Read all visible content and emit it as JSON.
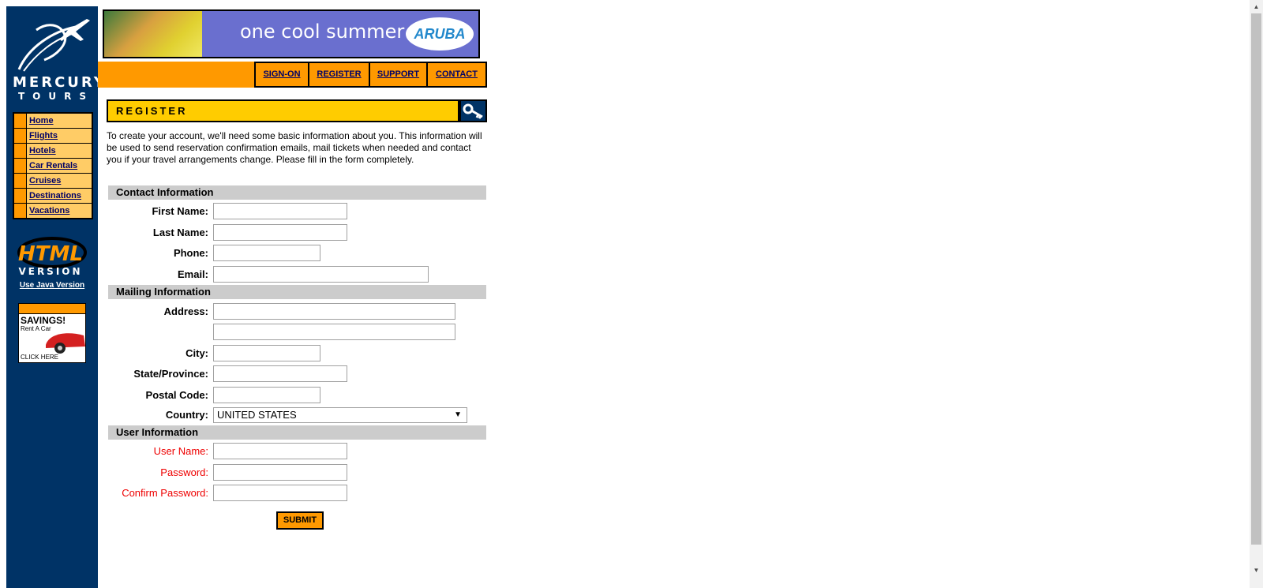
{
  "logo": {
    "line1": "MERCURY",
    "line2": "TOURS"
  },
  "sidenav": [
    "Home",
    "Flights",
    "Hotels",
    "Car Rentals",
    "Cruises",
    "Destinations",
    "Vacations"
  ],
  "badge": {
    "html": "HTML",
    "version": "VERSION"
  },
  "java_link": "Use Java Version",
  "ad": {
    "title": "SAVINGS!",
    "sub": "Rent A Car",
    "cta": "CLICK HERE"
  },
  "banner": {
    "text": "one cool summer",
    "brand": "ARUBA"
  },
  "topnav": [
    "SIGN-ON",
    "REGISTER",
    "SUPPORT",
    "CONTACT"
  ],
  "page_title": "REGISTER",
  "intro": "To create your account, we'll need some basic information about you. This information will be used to send reservation confirmation emails, mail tickets when needed and contact you if your travel arrangements change. Please fill in the form completely.",
  "sections": {
    "contact": "Contact Information",
    "mailing": "Mailing Information",
    "user": "User Information"
  },
  "labels": {
    "first_name": "First Name:",
    "last_name": "Last Name:",
    "phone": "Phone:",
    "email": "Email:",
    "address": "Address:",
    "city": "City:",
    "state": "State/Province:",
    "postal": "Postal Code:",
    "country": "Country:",
    "username": "User Name:",
    "password": "Password:",
    "confirm": "Confirm Password:"
  },
  "country_value": "UNITED STATES",
  "submit": "SUBMIT",
  "colors": {
    "navy": "#003366",
    "orange": "#ff9900",
    "yellow": "#ffcc00",
    "required": "#ee0000"
  }
}
